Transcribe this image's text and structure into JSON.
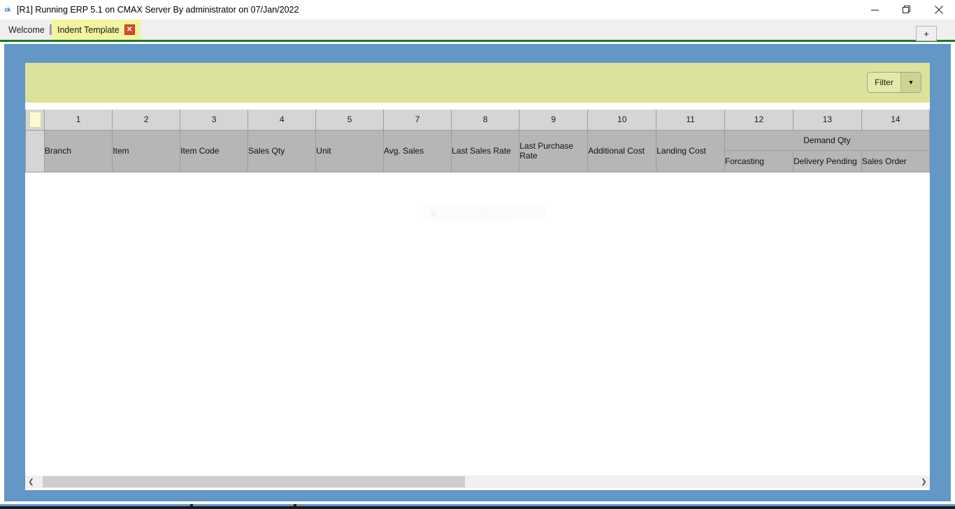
{
  "window": {
    "app_icon": "ck",
    "title": "[R1] Running ERP 5.1 on CMAX Server By administrator on 07/Jan/2022",
    "controls": {
      "minimize": "minimize-icon",
      "restore": "restore-icon",
      "close": "close-icon"
    }
  },
  "tabs": {
    "items": [
      {
        "label": "Welcome",
        "active": false,
        "close_icon": "close-icon"
      },
      {
        "label": "Indent Template",
        "active": true,
        "close_icon": "close-icon"
      }
    ],
    "add_tab_label": "+"
  },
  "toolbar": {
    "filter_label": "Filter",
    "filter_dropdown_icon": "chevron-down-icon"
  },
  "grid": {
    "column_numbers": [
      "1",
      "2",
      "3",
      "4",
      "5",
      "7",
      "8",
      "9",
      "10",
      "11",
      "12",
      "13",
      "14"
    ],
    "headers": [
      "Branch",
      "Item",
      "Item Code",
      "Sales Qty",
      "Unit",
      "Avg. Sales",
      "Last Sales Rate",
      "Last Purchase Rate",
      "Additional Cost",
      "Landing Cost"
    ],
    "group_header": "Demand Qty",
    "group_subheaders": [
      "Forcasting",
      "Delivery Pending",
      "Sales Order"
    ],
    "rows": []
  },
  "overlay": {
    "snip_label": "Rectangular Snip"
  },
  "scrollbar": {
    "left_arrow_icon": "chevron-left-icon",
    "right_arrow_icon": "chevron-right-icon"
  },
  "colors": {
    "workspace": "#6397c6",
    "filter_bar": "#dce29a",
    "active_tab": "#f3f3a0",
    "tab_underline": "#1d7a1d",
    "header_gray": "#b6b6b6",
    "numrow_gray": "#d5d5d5",
    "close_red": "#d94a2b"
  }
}
